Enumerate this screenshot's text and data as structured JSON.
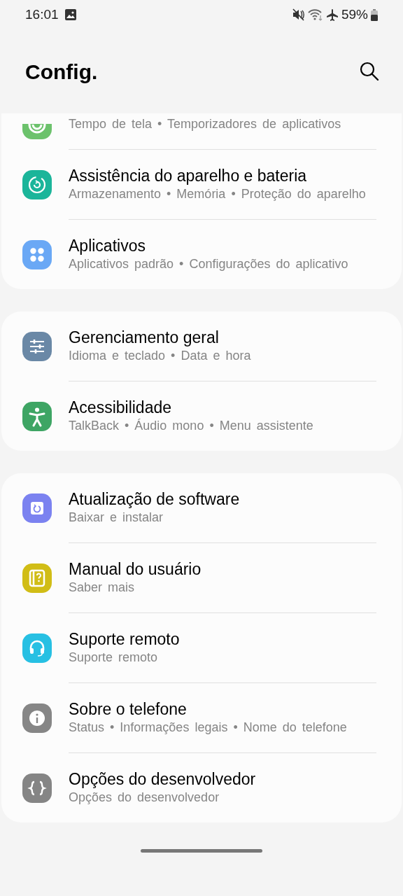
{
  "status_bar": {
    "time": "16:01",
    "battery": "59%"
  },
  "header": {
    "title": "Config."
  },
  "groups": [
    {
      "items": [
        {
          "color": "#6cc26c",
          "subtitle": "Tempo de tela • Temporizadores de aplicativos"
        },
        {
          "color": "#1bb59a",
          "title": "Assistência do aparelho e bateria",
          "subtitle": "Armazenamento • Memória • Proteção do aparelho"
        },
        {
          "color": "#6aa8f5",
          "title": "Aplicativos",
          "subtitle": "Aplicativos padrão • Configurações do aplicativo"
        }
      ]
    },
    {
      "items": [
        {
          "color": "#6a88a6",
          "title": "Gerenciamento geral",
          "subtitle": "Idioma e teclado • Data e hora"
        },
        {
          "color": "#3ea564",
          "title": "Acessibilidade",
          "subtitle": "TalkBack • Áudio mono • Menu assistente"
        }
      ]
    },
    {
      "items": [
        {
          "color": "#7b82f0",
          "title": "Atualização de software",
          "subtitle": "Baixar e instalar"
        },
        {
          "color": "#d1bd16",
          "title": "Manual do usuário",
          "subtitle": "Saber mais"
        },
        {
          "color": "#27c0e3",
          "title": "Suporte remoto",
          "subtitle": "Suporte remoto"
        },
        {
          "color": "#868686",
          "title": "Sobre o telefone",
          "subtitle": "Status • Informações legais • Nome do telefone"
        },
        {
          "color": "#858585",
          "title": "Opções do desenvolvedor",
          "subtitle": "Opções do desenvolvedor"
        }
      ]
    }
  ]
}
